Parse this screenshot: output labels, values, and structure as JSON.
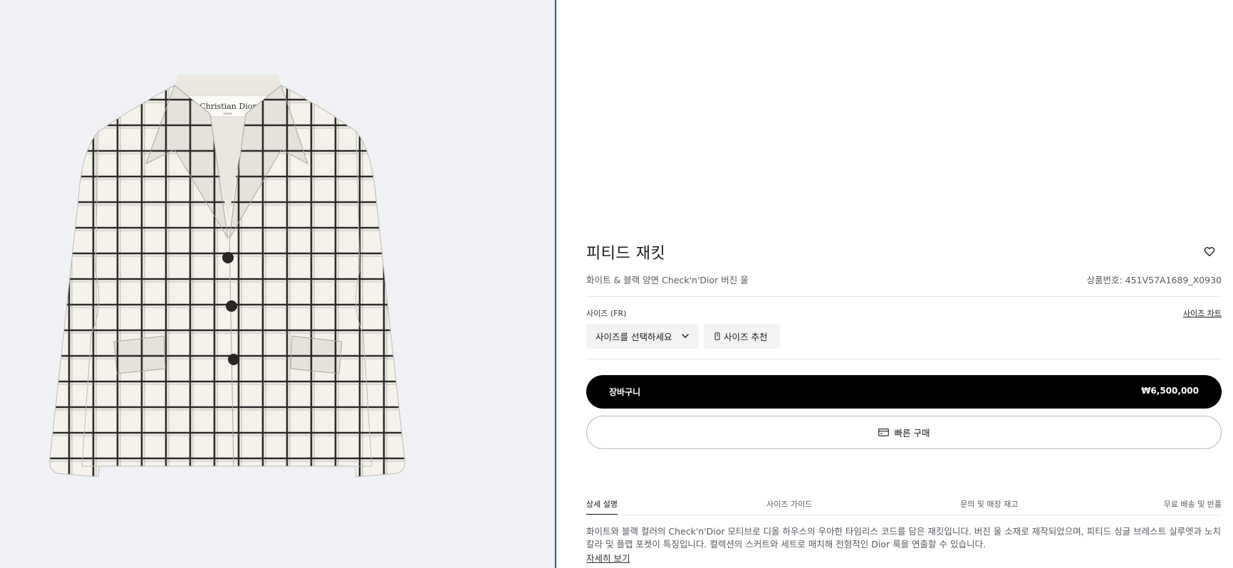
{
  "product": {
    "image_brand_label": "Christian Dior",
    "image_brand_sub": "PARIS",
    "title": "피티드 재킷",
    "subtitle": "화이트 & 블랙 양면 Check'n'Dior 버진 울",
    "reference": "상품번호: 451V57A1689_X0930"
  },
  "size": {
    "label": "사이즈 (FR)",
    "chart_link": "사이즈 차트",
    "select_placeholder": "사이즈를 선택하세요",
    "recommend_label": "사이즈 추천"
  },
  "actions": {
    "cart_label": "장바구니",
    "price": "₩6,500,000",
    "quick_buy_label": "빠른 구매"
  },
  "tabs": [
    {
      "label": "상세 설명",
      "active": true
    },
    {
      "label": "사이즈 가이드",
      "active": false
    },
    {
      "label": "문의 및 매장 재고",
      "active": false
    },
    {
      "label": "무료 배송 및 반품",
      "active": false
    }
  ],
  "description": {
    "line1": "화이트와 블랙 컬러의 Check'n'Dior 모티브로 디올 하우스의 우아한 타임리스 코드를 담은 재킷입니다. 버진 울 소재로 제작되었으며, 피티드 싱글 브레스트 실루엣과 노치",
    "line2": "칼라 및 플랩 포켓이 특징입니다. 컬렉션의 스커트와 세트로 매치해 전형적인 Dior 룩을 연출할 수 있습니다.",
    "more_link": "자세히 보기"
  },
  "icons": {
    "wishlist": "heart-outline-icon",
    "dropdown": "chevron-down-icon",
    "recommend": "phone-ruler-icon",
    "quick_buy": "credit-card-icon"
  },
  "colors": {
    "image_background": "#eff1f4",
    "divider": "#2a5ca8",
    "primary_button": "#000000",
    "chip_background": "#f2f3f5"
  }
}
